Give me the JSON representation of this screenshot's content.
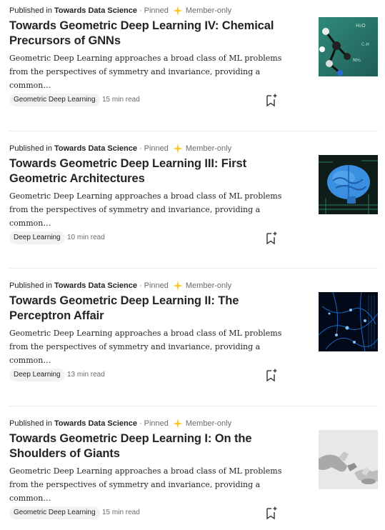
{
  "articles": [
    {
      "published_in": "Published in",
      "publication": "Towards Data Science",
      "pinned": "Pinned",
      "member_only": "Member-only",
      "title": "Towards Geometric Deep Learning IV: Chemical Precursors of GNNs",
      "excerpt": "Geometric Deep Learning approaches a broad class of ML problems from the perspectives of symmetry and invariance, providing a common…",
      "tag": "Geometric Deep Learning",
      "read_time": "15 min read",
      "thumbnail_icon": "chemistry-molecule-image"
    },
    {
      "published_in": "Published in",
      "publication": "Towards Data Science",
      "pinned": "Pinned",
      "member_only": "Member-only",
      "title": "Towards Geometric Deep Learning III: First Geometric Architectures",
      "excerpt": "Geometric Deep Learning approaches a broad class of ML problems from the perspectives of symmetry and invariance, providing a common…",
      "tag": "Deep Learning",
      "read_time": "10 min read",
      "thumbnail_icon": "brain-circuit-image"
    },
    {
      "published_in": "Published in",
      "publication": "Towards Data Science",
      "pinned": "Pinned",
      "member_only": "Member-only",
      "title": "Towards Geometric Deep Learning II: The Perceptron Affair",
      "excerpt": "Geometric Deep Learning approaches a broad class of ML problems from the perspectives of symmetry and invariance, providing a common…",
      "tag": "Deep Learning",
      "read_time": "13 min read",
      "thumbnail_icon": "neural-network-image"
    },
    {
      "published_in": "Published in",
      "publication": "Towards Data Science",
      "pinned": "Pinned",
      "member_only": "Member-only",
      "title": "Towards Geometric Deep Learning I: On the Shoulders of Giants",
      "excerpt": "Geometric Deep Learning approaches a broad class of ML problems from the perspectives of symmetry and invariance, providing a common…",
      "tag": "Geometric Deep Learning",
      "read_time": "15 min read",
      "thumbnail_icon": "robot-hand-image"
    }
  ],
  "colors": {
    "member_star": "#ffc017",
    "muted_text": "#6b6b6b",
    "tag_bg": "#f2f2f2"
  }
}
